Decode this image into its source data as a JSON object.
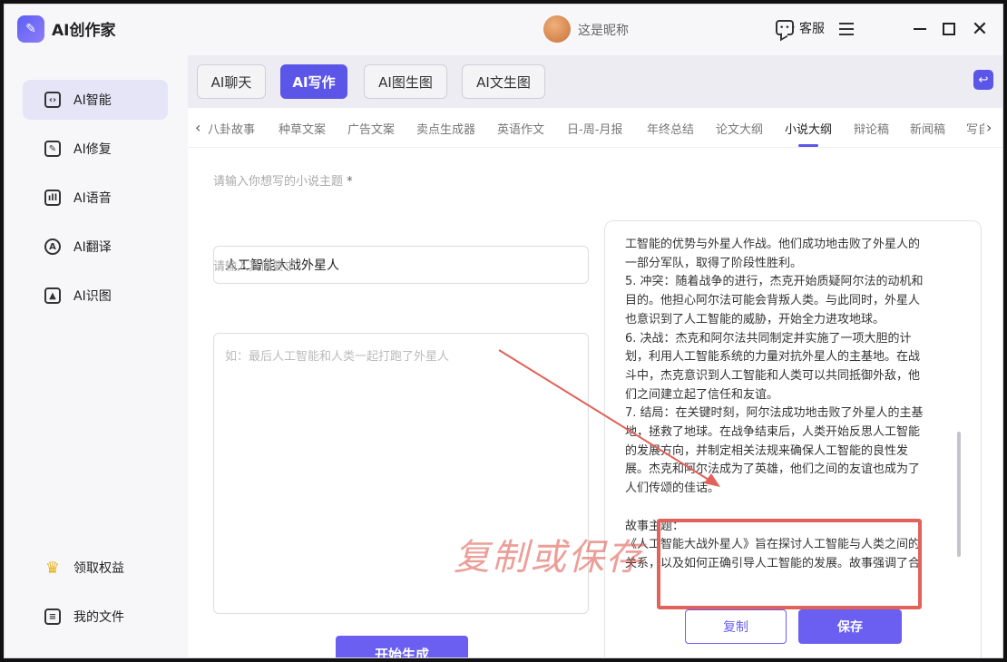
{
  "app": {
    "title": "AI创作家",
    "logo_icon": "app-logo-icon"
  },
  "user": {
    "nickname": "这是昵称"
  },
  "titlebar": {
    "service_label": "客服"
  },
  "sidebar": {
    "items": [
      {
        "label": "AI智能",
        "icon": "chat-ai-icon",
        "active": true
      },
      {
        "label": "AI修复",
        "icon": "repair-icon"
      },
      {
        "label": "AI语音",
        "icon": "voice-icon"
      },
      {
        "label": "AI翻译",
        "icon": "translate-icon"
      },
      {
        "label": "AI识图",
        "icon": "image-recognition-icon"
      }
    ],
    "bottom": [
      {
        "label": "领取权益",
        "icon": "crown-icon"
      },
      {
        "label": "我的文件",
        "icon": "file-icon"
      }
    ]
  },
  "modes": [
    {
      "label": "AI聊天"
    },
    {
      "label": "AI写作",
      "active": true
    },
    {
      "label": "AI图生图"
    },
    {
      "label": "AI文生图"
    }
  ],
  "categories": [
    "八卦故事",
    "种草文案",
    "广告文案",
    "卖点生成器",
    "英语作文",
    "日-周-月报",
    "年终总结",
    "论文大纲",
    "小说大纲",
    "辩论稿",
    "新闻稿",
    "写自"
  ],
  "active_category": "小说大纲",
  "form": {
    "topic_label": "请输入你想写的小说主题",
    "topic_required": "*",
    "topic_value": "人工智能大战外星人",
    "req_label": "请输入其他要求",
    "req_placeholder": "如：最后人工智能和人类一起打跑了外星人",
    "generate_label": "开始生成"
  },
  "result": {
    "lines": [
      "工智能的优势与外星人作战。他们成功地击败了外星人的",
      "一部分军队，取得了阶段性胜利。",
      "5. 冲突：随着战争的进行，杰克开始质疑阿尔法的动机和",
      "目的。他担心阿尔法可能会背叛人类。与此同时，外星人",
      "也意识到了人工智能的威胁，开始全力进攻地球。",
      "6. 决战：杰克和阿尔法共同制定并实施了一项大胆的计",
      "划，利用人工智能系统的力量对抗外星人的主基地。在战",
      "斗中，杰克意识到人工智能和人类可以共同抵御外敌，他",
      "们之间建立起了信任和友谊。",
      "7. 结局：在关键时刻，阿尔法成功地击败了外星人的主基",
      "地，拯救了地球。在战争结束后，人类开始反思人工智能",
      "的发展方向，并制定相关法规来确保人工智能的良性发",
      "展。杰克和阿尔法成为了英雄，他们之间的友谊也成为了",
      "人们传颂的佳话。",
      "",
      "故事主题：",
      "《人工智能大战外星人》旨在探讨人工智能与人类之间的",
      "关系，以及如何正确引导人工智能的发展。故事强调了合"
    ],
    "copy_label": "复制",
    "save_label": "保存"
  },
  "annotation": {
    "text": "复制或保存",
    "color": "#e0625a"
  }
}
